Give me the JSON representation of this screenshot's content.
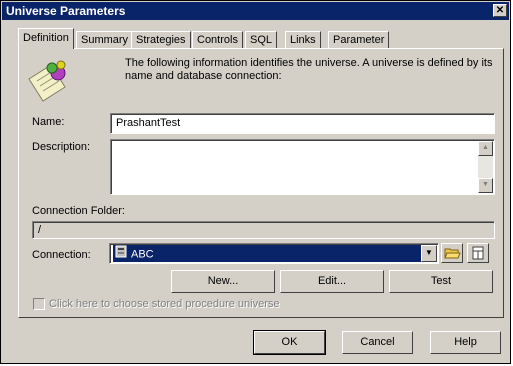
{
  "window": {
    "title": "Universe Parameters",
    "close_glyph": "✕"
  },
  "tabs": [
    {
      "label": "Definition",
      "active": true
    },
    {
      "label": "Summary"
    },
    {
      "label": "Strategies"
    },
    {
      "label": "Controls"
    },
    {
      "label": "SQL"
    },
    {
      "label": "Links"
    },
    {
      "label": "Parameter"
    }
  ],
  "definition": {
    "intro": "The following information identifies the universe. A universe is defined by its name and database connection:",
    "icon": "universe-icon",
    "name_label": "Name:",
    "name_value": "PrashantTest",
    "description_label": "Description:",
    "description_value": "",
    "connection_folder_label": "Connection Folder:",
    "connection_folder_value": "/",
    "connection_label": "Connection:",
    "connection_value": "ABC",
    "new_button": "New...",
    "edit_button": "Edit...",
    "test_button": "Test",
    "stored_proc_label": "Click here to choose stored procedure universe"
  },
  "footer": {
    "ok": "OK",
    "cancel": "Cancel",
    "help": "Help"
  },
  "colors": {
    "titlebar": "#0a246a",
    "face": "#d4d0c8",
    "selection": "#0a246a"
  }
}
